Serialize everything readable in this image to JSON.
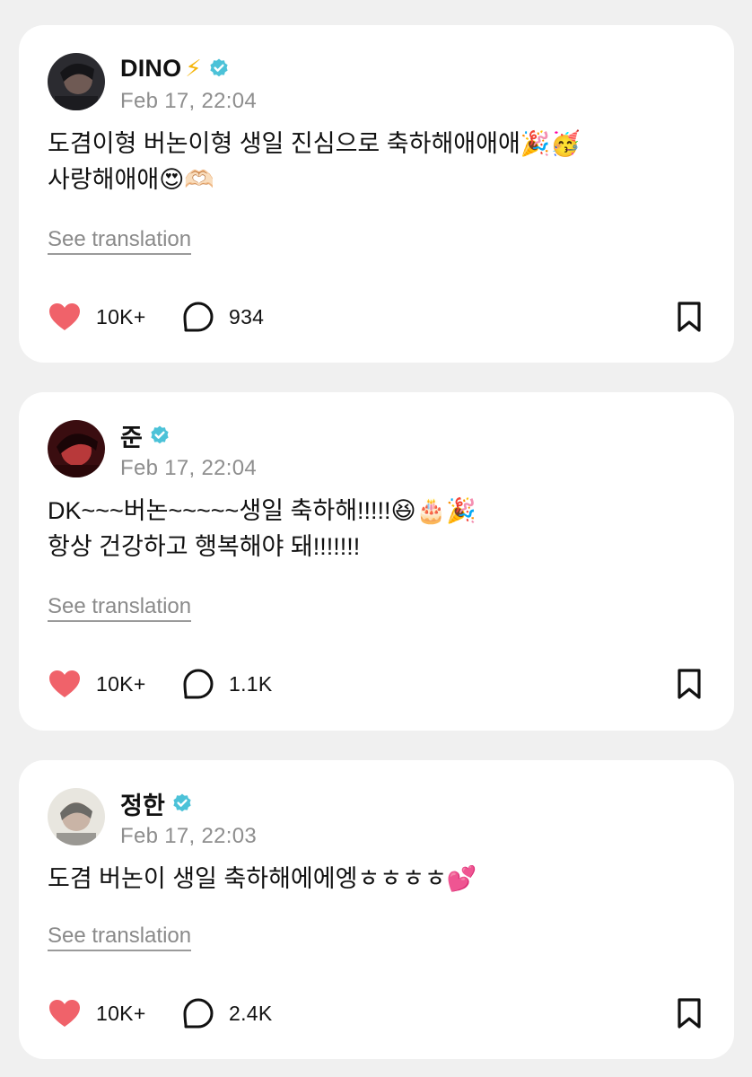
{
  "posts": [
    {
      "name": "DINO",
      "name_suffix": "⚡",
      "date": "Feb 17, 22:04",
      "lines": [
        "도겸이형 버논이형 생일 진심으로 축하해애애애🎉🥳",
        "사랑해애애😍🫶🏻"
      ],
      "translation_label": "See translation",
      "likes": "10K+",
      "comments": "934",
      "avatar_colors": [
        "#2b2b30",
        "#6f5a54"
      ]
    },
    {
      "name": "준",
      "name_suffix": "",
      "date": "Feb 17, 22:04",
      "lines": [
        "DK~~~버논~~~~~생일 축하해!!!!!😆🎂🎉",
        "항상 건강하고 행복해야 돼!!!!!!!"
      ],
      "translation_label": "See translation",
      "likes": "10K+",
      "comments": "1.1K",
      "avatar_colors": [
        "#3a0d10",
        "#b8393a"
      ]
    },
    {
      "name": "정한",
      "name_suffix": "",
      "date": "Feb 17, 22:03",
      "lines": [
        "도겸 버논이 생일 축하해에에엥ㅎㅎㅎㅎ💕"
      ],
      "translation_label": "See translation",
      "likes": "10K+",
      "comments": "2.4K",
      "avatar_colors": [
        "#e8e6df",
        "#6b6a66"
      ]
    }
  ],
  "colors": {
    "verified_badge": "#4cc2d8",
    "heart": "#f0626a",
    "date_text": "#8e8e8e",
    "page_background": "#f0f0f0",
    "card_background": "#ffffff"
  },
  "icons": {
    "like": "heart-icon",
    "comment": "speech-bubble-icon",
    "save": "bookmark-icon",
    "verified": "verified-badge-icon"
  }
}
